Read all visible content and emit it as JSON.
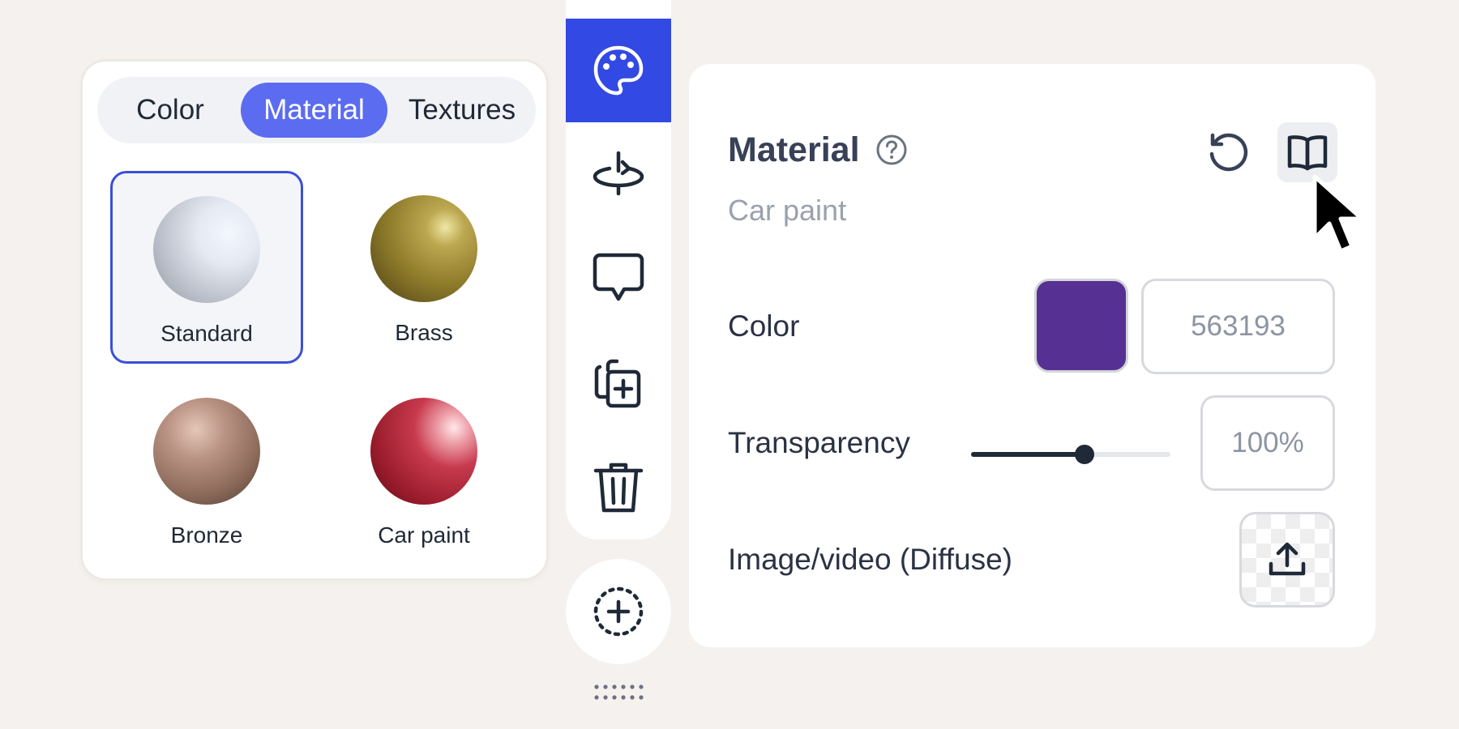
{
  "material_panel": {
    "tabs": [
      {
        "label": "Color",
        "active": false
      },
      {
        "label": "Material",
        "active": true
      },
      {
        "label": "Textures",
        "active": false
      }
    ],
    "swatches": [
      {
        "label": "Standard",
        "selected": true
      },
      {
        "label": "Brass",
        "selected": false
      },
      {
        "label": "Bronze",
        "selected": false
      },
      {
        "label": "Car paint",
        "selected": false
      }
    ]
  },
  "toolbar": {
    "tools": [
      "palette-icon",
      "rotate-icon",
      "comment-icon",
      "duplicate-icon",
      "trash-icon"
    ],
    "active_tool": "palette-icon",
    "add_button_icon": "add-circle-icon"
  },
  "properties": {
    "title": "Material",
    "subtitle": "Car paint",
    "color": {
      "label": "Color",
      "swatch": "#563193",
      "hex": "563193"
    },
    "transparency": {
      "label": "Transparency",
      "value": "100%",
      "slider_fraction": 0.57
    },
    "image": {
      "label": "Image/video (Diffuse)"
    }
  },
  "colors": {
    "accent": "#3349e3",
    "tab_active": "#5b6cf0",
    "selected_border": "#3a4fd8",
    "background": "#f4f1ee"
  }
}
